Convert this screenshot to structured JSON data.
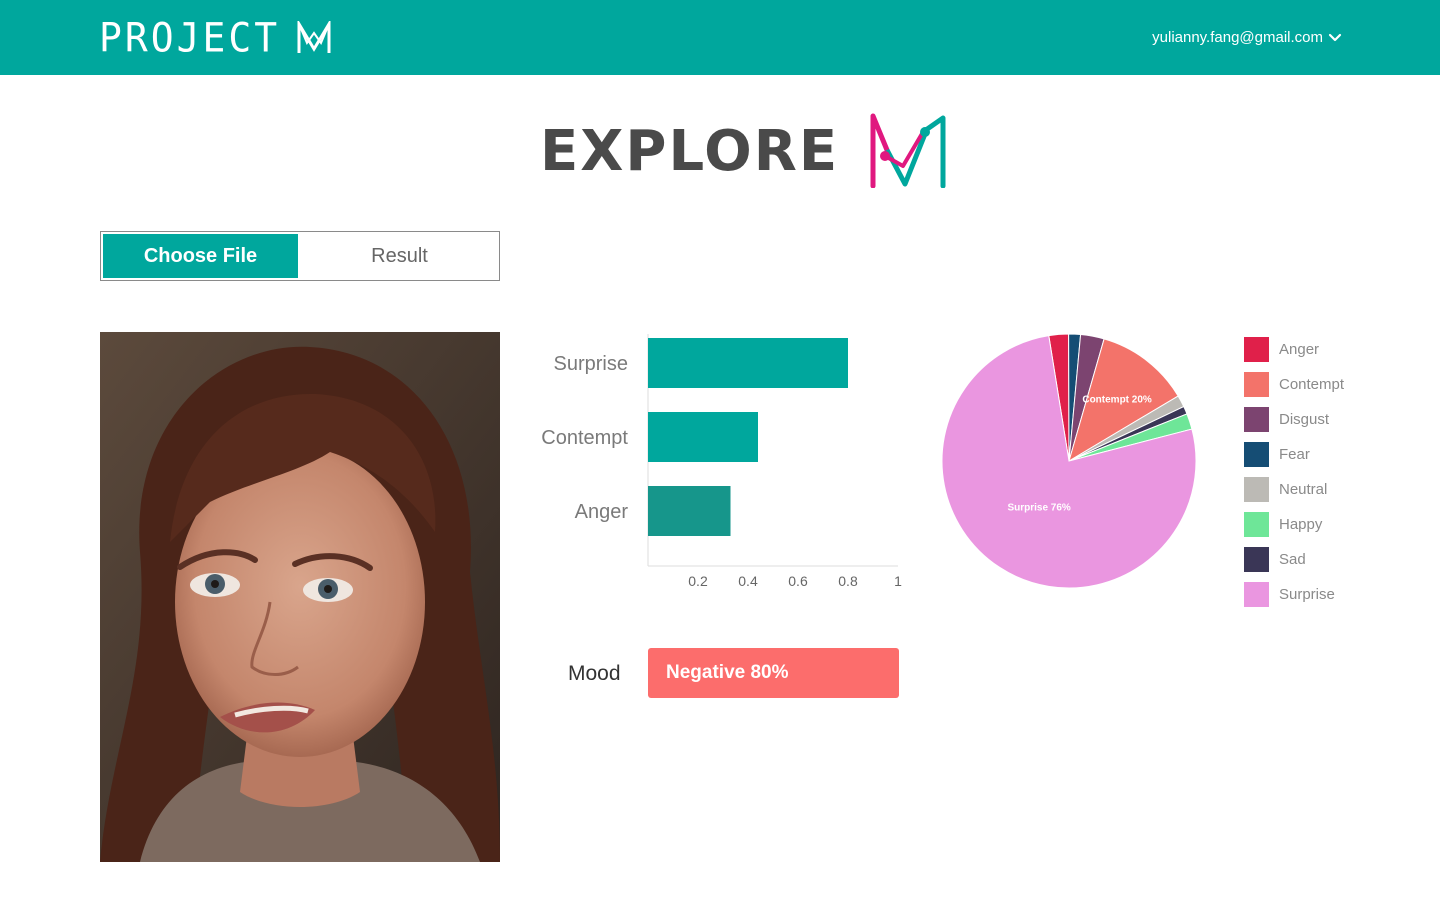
{
  "header": {
    "brand_text": "PROJECT",
    "user_email": "yulianny.fang@gmail.com",
    "background": "#00a79d"
  },
  "page": {
    "title": "EXPLORE"
  },
  "tabs": [
    {
      "label": "Choose File",
      "active": true
    },
    {
      "label": "Result",
      "active": false
    }
  ],
  "icons": {
    "brand_logo": "m-logo-icon",
    "explore_logo": "m-logo-icon",
    "user_menu_caret": "chevron-down-icon"
  },
  "mood": {
    "label": "Mood",
    "value_text": "Negative 80%",
    "color": "#fc6d6c"
  },
  "chart_data": [
    {
      "type": "bar",
      "orientation": "horizontal",
      "categories": [
        "Surprise",
        "Contempt",
        "Anger"
      ],
      "values": [
        0.8,
        0.44,
        0.33
      ],
      "colors": [
        "#00a79d",
        "#00a79d",
        "#16968b"
      ],
      "xticks": [
        "0.2",
        "0.4",
        "0.6",
        "0.8",
        "1"
      ],
      "xlim": [
        0,
        1
      ],
      "grid": false
    },
    {
      "type": "pie",
      "slices": [
        {
          "label": "Anger",
          "value": 2.5,
          "color": "#e0204a"
        },
        {
          "label": "Fear",
          "value": 1.5,
          "color": "#154d74"
        },
        {
          "label": "Disgust",
          "value": 3,
          "color": "#7c4470"
        },
        {
          "label": "Contempt",
          "value": 12,
          "color": "#f3736a"
        },
        {
          "label": "Neutral",
          "value": 1.5,
          "color": "#bcbab5"
        },
        {
          "label": "Sad",
          "value": 1,
          "color": "#3a3656"
        },
        {
          "label": "Happy",
          "value": 2,
          "color": "#6ee698"
        },
        {
          "label": "Surprise",
          "value": 76.5,
          "color": "#ea96e0"
        }
      ],
      "slice_labels": [
        {
          "slice": "Contempt",
          "text": "Contempt 20%"
        },
        {
          "slice": "Surprise",
          "text": "Surprise 76%"
        }
      ],
      "legend": [
        {
          "label": "Anger",
          "color": "#e0204a"
        },
        {
          "label": "Contempt",
          "color": "#f3736a"
        },
        {
          "label": "Disgust",
          "color": "#7c4470"
        },
        {
          "label": "Fear",
          "color": "#154d74"
        },
        {
          "label": "Neutral",
          "color": "#bcbab5"
        },
        {
          "label": "Happy",
          "color": "#6ee698"
        },
        {
          "label": "Sad",
          "color": "#3a3656"
        },
        {
          "label": "Surprise",
          "color": "#ea96e0"
        }
      ],
      "legend_position": "right"
    }
  ]
}
